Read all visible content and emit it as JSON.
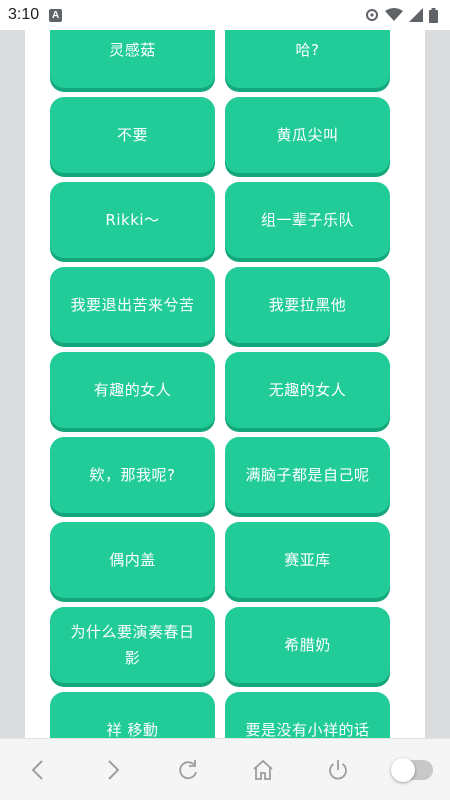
{
  "status_bar": {
    "time": "3:10",
    "notification_letter": "A"
  },
  "buttons": [
    "灵感菇",
    "哈?",
    "不要",
    "黄瓜尖叫",
    "Rikki〜",
    "组一辈子乐队",
    "我要退出苦来兮苦",
    "我要拉黑他",
    "有趣的女人",
    "无趣的女人",
    "欸，那我呢?",
    "满脑子都是自己呢",
    "偶内盖",
    "赛亚库",
    "为什么要演奏春日影",
    "希腊奶",
    "祥 移動",
    "要是没有小祥的话"
  ],
  "colors": {
    "button": "#22cc98",
    "button_shadow": "#14a77b",
    "text": "#ffffff"
  },
  "nav": {
    "icons": [
      "back-icon",
      "forward-icon",
      "refresh-icon",
      "home-icon",
      "power-icon",
      "toggle-switch"
    ],
    "toggle_on": false
  }
}
